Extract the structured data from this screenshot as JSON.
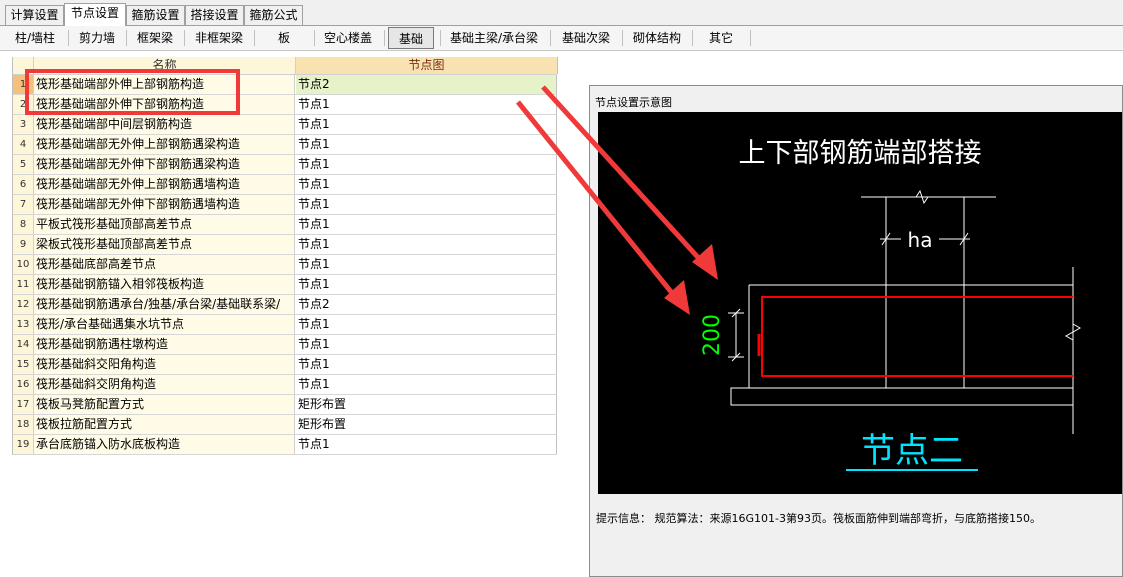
{
  "tabs": [
    "计算设置",
    "节点设置",
    "箍筋设置",
    "搭接设置",
    "箍筋公式"
  ],
  "subtabs": [
    "柱/墙柱",
    "剪力墙",
    "框架梁",
    "非框架梁",
    "板",
    "空心楼盖",
    "基础",
    "基础主梁/承台梁",
    "基础次梁",
    "砌体结构",
    "其它"
  ],
  "grid": {
    "col_name": "名称",
    "col_node": "节点图",
    "rows": [
      {
        "num": "1",
        "name": "筏形基础端部外伸上部钢筋构造",
        "node": "节点2"
      },
      {
        "num": "2",
        "name": "筏形基础端部外伸下部钢筋构造",
        "node": "节点1"
      },
      {
        "num": "3",
        "name": "筏形基础端部中间层钢筋构造",
        "node": "节点1"
      },
      {
        "num": "4",
        "name": "筏形基础端部无外伸上部钢筋遇梁构造",
        "node": "节点1"
      },
      {
        "num": "5",
        "name": "筏形基础端部无外伸下部钢筋遇梁构造",
        "node": "节点1"
      },
      {
        "num": "6",
        "name": "筏形基础端部无外伸上部钢筋遇墙构造",
        "node": "节点1"
      },
      {
        "num": "7",
        "name": "筏形基础端部无外伸下部钢筋遇墙构造",
        "node": "节点1"
      },
      {
        "num": "8",
        "name": "平板式筏形基础顶部高差节点",
        "node": "节点1"
      },
      {
        "num": "9",
        "name": "梁板式筏形基础顶部高差节点",
        "node": "节点1"
      },
      {
        "num": "10",
        "name": "筏形基础底部高差节点",
        "node": "节点1"
      },
      {
        "num": "11",
        "name": "筏形基础钢筋锚入相邻筏板构造",
        "node": "节点1"
      },
      {
        "num": "12",
        "name": "筏形基础钢筋遇承台/独基/承台梁/基础联系梁/",
        "node": "节点2"
      },
      {
        "num": "13",
        "name": "筏形/承台基础遇集水坑节点",
        "node": "节点1"
      },
      {
        "num": "14",
        "name": "筏形基础钢筋遇柱墩构造",
        "node": "节点1"
      },
      {
        "num": "15",
        "name": "筏形基础斜交阳角构造",
        "node": "节点1"
      },
      {
        "num": "16",
        "name": "筏形基础斜交阴角构造",
        "node": "节点1"
      },
      {
        "num": "17",
        "name": "筏板马凳筋配置方式",
        "node": "矩形布置"
      },
      {
        "num": "18",
        "name": "筏板拉筋配置方式",
        "node": "矩形布置"
      },
      {
        "num": "19",
        "name": "承台底筋锚入防水底板构造",
        "node": "节点1"
      }
    ]
  },
  "preview": {
    "panel_title": "节点设置示意图",
    "diagram_title": "上下部钢筋端部搭接",
    "dim_ha": "ha",
    "dim_200": "200",
    "node_label": "节点二",
    "hint_label": "提示信息：",
    "hint_text": "规范算法：来源16G101-3第93页。筏板面筋伸到端部弯折，与底筋搭接150。"
  },
  "colors": {
    "annotation_red": "#f03a3a",
    "rebar_red": "#ff0000",
    "dim_green": "#00ff00",
    "node_cyan": "#00e5ff",
    "selected_row": "#e6f2c8"
  }
}
